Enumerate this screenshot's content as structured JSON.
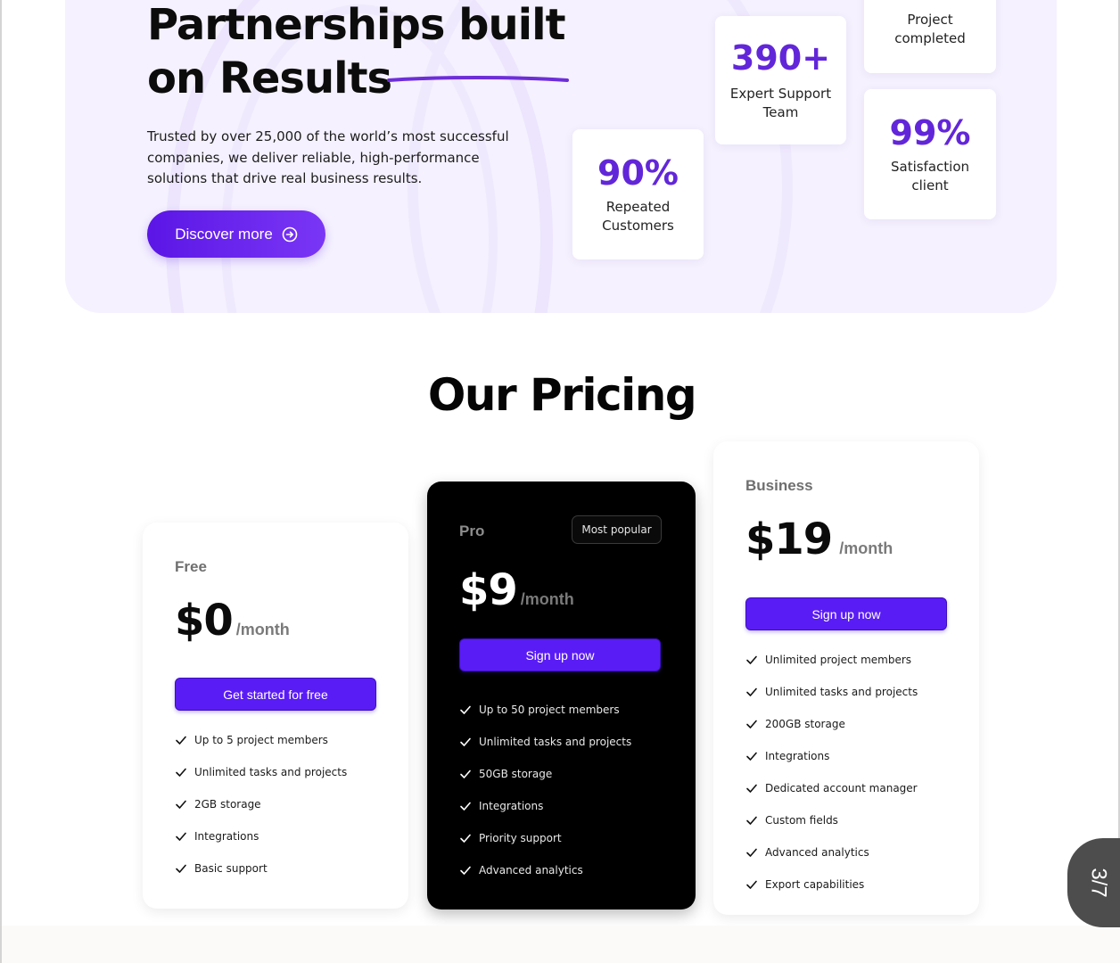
{
  "hero": {
    "title_line1": "Partnerships built",
    "title_line2": "on Results",
    "description": "Trusted by over 25,000 of the world’s most successful companies, we deliver reliable, high-performance solutions that drive real business results.",
    "cta_label": "Discover more",
    "accent_color": "#6226d9"
  },
  "stats": [
    {
      "value": "",
      "label": "Project completed"
    },
    {
      "value": "390+",
      "label": "Expert Support Team"
    },
    {
      "value": "99%",
      "label": "Satisfaction client"
    },
    {
      "value": "90%",
      "label": "Repeated Customers"
    }
  ],
  "pricing": {
    "title": "Our Pricing",
    "plans": [
      {
        "name": "Free",
        "price": "$0",
        "period": "/month",
        "button": "Get started for free",
        "features": [
          "Up to 5 project members",
          "Unlimited tasks and projects",
          "2GB storage",
          "Integrations",
          "Basic support"
        ]
      },
      {
        "name": "Pro",
        "badge": "Most popular",
        "price": "$9",
        "period": "/month",
        "button": "Sign up now",
        "features": [
          "Up to 50 project members",
          "Unlimited tasks and projects",
          "50GB storage",
          "Integrations",
          "Priority support",
          "Advanced analytics"
        ]
      },
      {
        "name": "Business",
        "price": "$19",
        "period": "/month",
        "button": "Sign up now",
        "features": [
          "Unlimited project members",
          "Unlimited tasks and projects",
          "200GB storage",
          "Integrations",
          "Dedicated account manager",
          "Custom fields",
          "Advanced analytics",
          "Export capabilities"
        ]
      }
    ],
    "button_color": "#5a1cf5"
  },
  "page_indicator": "3/7"
}
